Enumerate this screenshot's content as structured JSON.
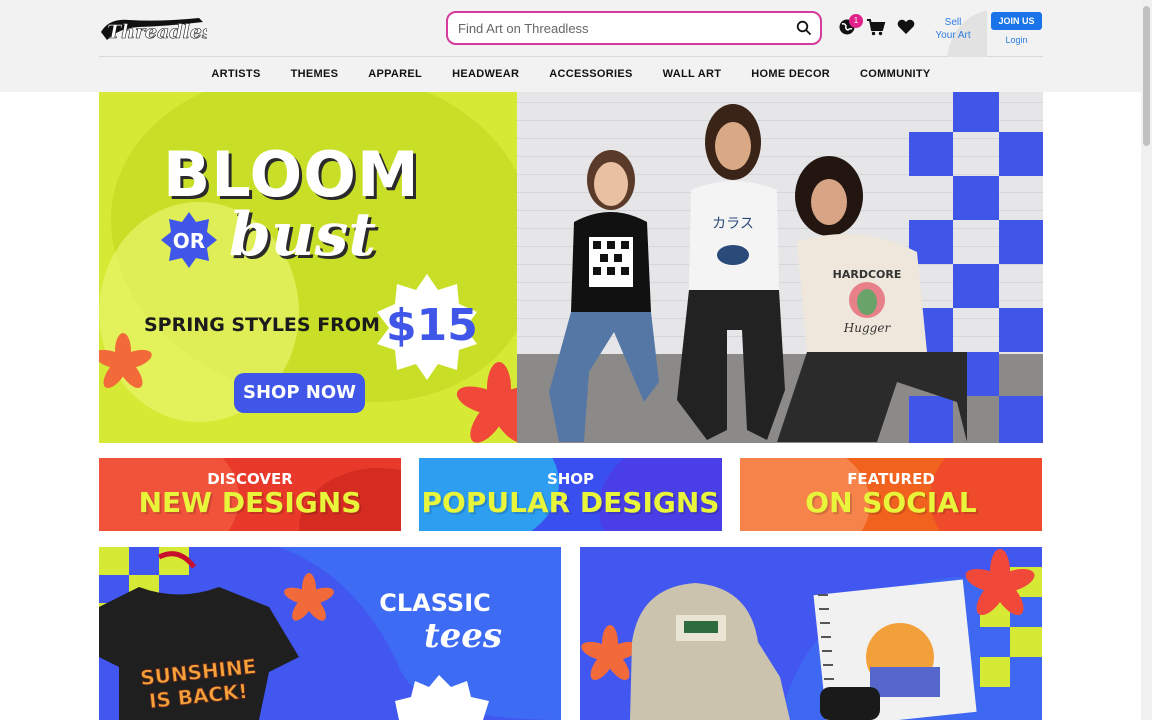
{
  "header": {
    "logo_text": "Threadless",
    "search_placeholder": "Find Art on Threadless",
    "notification_count": "1",
    "sell_label_line1": "Sell",
    "sell_label_line2": "Your Art",
    "join_label": "JOIN US",
    "login_label": "Login"
  },
  "nav": {
    "items": [
      {
        "label": "ARTISTS"
      },
      {
        "label": "THEMES"
      },
      {
        "label": "APPAREL"
      },
      {
        "label": "HEADWEAR"
      },
      {
        "label": "ACCESSORIES"
      },
      {
        "label": "WALL ART"
      },
      {
        "label": "HOME DECOR"
      },
      {
        "label": "COMMUNITY"
      }
    ]
  },
  "hero": {
    "headline": "BLOOM",
    "or_text": "OR",
    "bust_text": "bust",
    "subline": "SPRING STYLES FROM",
    "price": "$15",
    "cta": "SHOP NOW",
    "shirt1_text": "カラス",
    "shirt2_text_line1": "HARDCORE",
    "shirt2_text_line2": "Hugger"
  },
  "categories": [
    {
      "small": "DISCOVER",
      "big": "NEW DESIGNS",
      "color": "#e8392a"
    },
    {
      "small": "SHOP",
      "big": "POPULAR DESIGNS",
      "color": "#3a4ff0"
    },
    {
      "small": "FEATURED",
      "big": "ON SOCIAL",
      "color": "#f2621f"
    }
  ],
  "promos": {
    "left_line1": "CLASSIC",
    "left_line2": "tees",
    "left_shirt_text_line1": "SUNSHINE",
    "left_shirt_text_line2": "IS BACK!"
  },
  "colors": {
    "accent_blue": "#3f56e8",
    "hero_yellow": "#d6ea35",
    "link_blue": "#2d7de0",
    "search_border": "#d63a9d",
    "flower_orange": "#f36a3a"
  }
}
